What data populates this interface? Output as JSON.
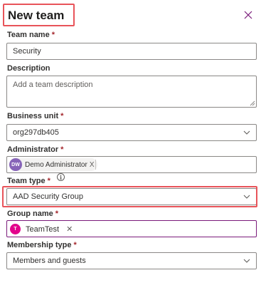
{
  "dialog": {
    "title": "New team",
    "close_icon": "close-icon"
  },
  "fields": {
    "team_name": {
      "label": "Team name",
      "required": "*",
      "value": "Security"
    },
    "description": {
      "label": "Description",
      "placeholder": "Add a team description"
    },
    "business_unit": {
      "label": "Business unit",
      "required": "*",
      "value": "org297db405"
    },
    "administrator": {
      "label": "Administrator",
      "required": "*",
      "persona": {
        "initials": "DW",
        "name": "Demo Administrator",
        "remove": "X",
        "color": "#8764b8"
      }
    },
    "team_type": {
      "label": "Team type",
      "required": "*",
      "info": "i",
      "value": "AAD Security Group"
    },
    "group_name": {
      "label": "Group name",
      "required": "*",
      "tag": {
        "initial": "T",
        "name": "TeamTest",
        "remove": "✕",
        "color": "#e3008c"
      }
    },
    "membership_type": {
      "label": "Membership type",
      "required": "*",
      "value": "Members and guests"
    }
  },
  "colors": {
    "highlight": "#e8545a",
    "required": "#a4262c",
    "group_border": "#7a1a7a"
  }
}
